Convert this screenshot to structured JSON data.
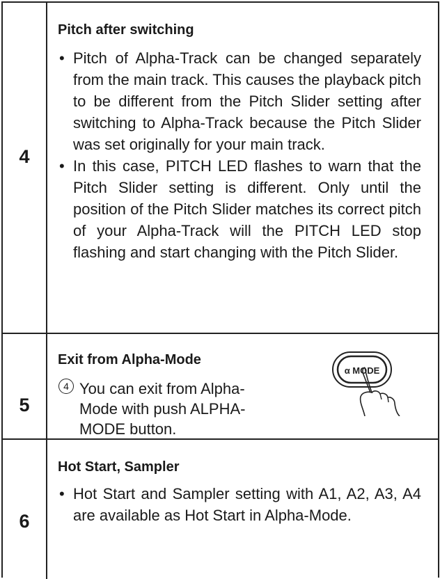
{
  "rows": [
    {
      "number": "4",
      "title": "Pitch after switching",
      "bullets": [
        "Pitch of Alpha-Track can be changed separately from the main track. This causes the playback pitch to be different from the Pitch Slider setting after switching to Alpha-Track because the Pitch Slider was set originally for your main track.",
        "In this case, PITCH LED flashes to warn that the Pitch Slider setting is different. Only until the position of the Pitch Slider matches its correct pitch of your Alpha-Track will the PITCH LED stop flashing and start changing with the Pitch Slider."
      ]
    },
    {
      "number": "5",
      "title": "Exit from Alpha-Mode",
      "step_number": "4",
      "step_text": "You can exit from Alpha-Mode with push ALPHA-MODE button.",
      "button_label": "α MODE"
    },
    {
      "number": "6",
      "title": "Hot Start, Sampler",
      "bullets": [
        "Hot Start and Sampler setting with A1, A2, A3, A4 are available as Hot Start in Alpha-Mode."
      ]
    }
  ],
  "bullet_glyph": "•"
}
